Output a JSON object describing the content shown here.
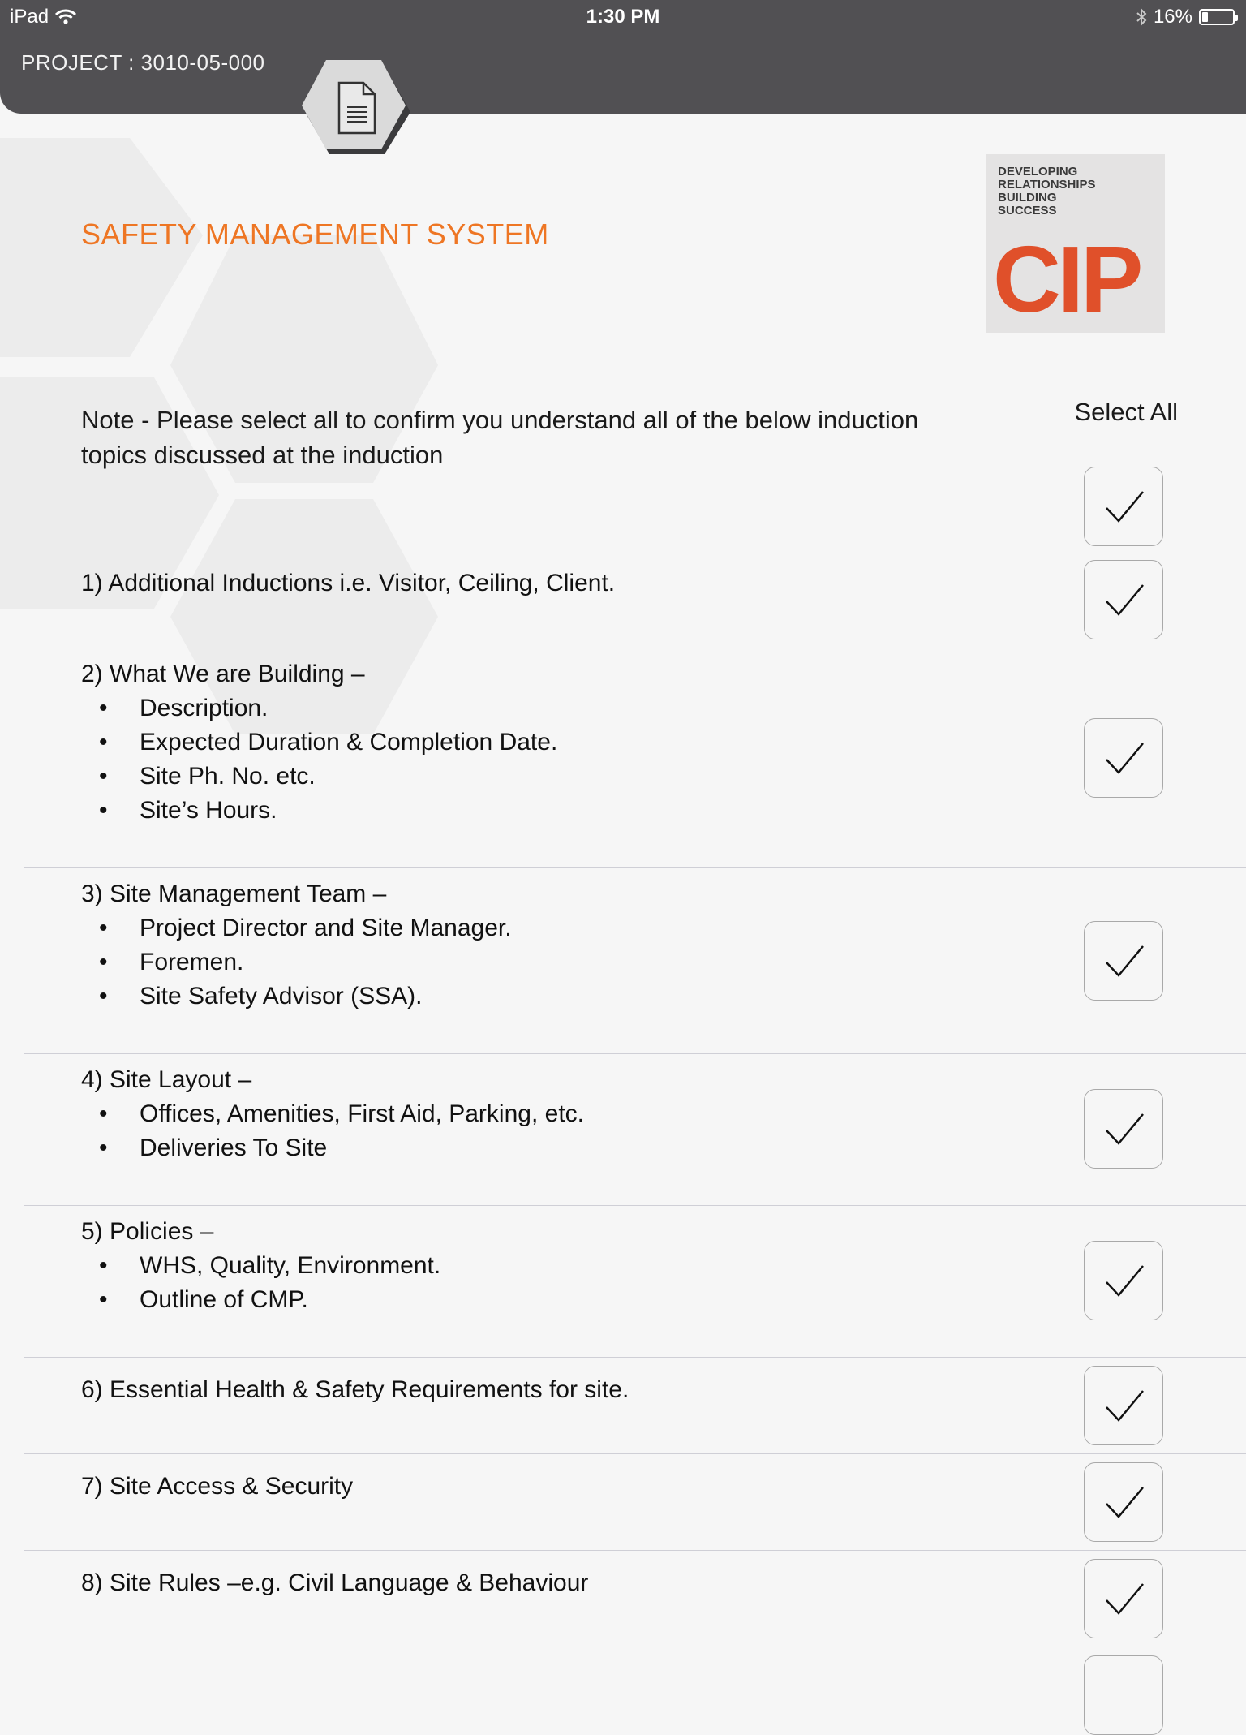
{
  "status_bar": {
    "device": "iPad",
    "time": "1:30 PM",
    "battery": "16%",
    "battery_level": 0.16
  },
  "header": {
    "project": "PROJECT : 3010-05-000",
    "doc_icon": "document-icon"
  },
  "title": "SAFETY MANAGEMENT SYSTEM",
  "logo": {
    "tagline": [
      "DEVELOPING",
      "RELATIONSHIPS",
      "BUILDING",
      "SUCCESS"
    ],
    "mark": "CIP",
    "color": "#e0502a"
  },
  "note": "Note - Please select all to confirm you understand all of the below induction topics discussed at the induction",
  "select_all": {
    "label": "Select All",
    "checked": true
  },
  "colors": {
    "accent": "#ee7624",
    "header": "#515053"
  },
  "items": [
    {
      "title": "1) Additional Inductions i.e. Visitor, Ceiling, Client.",
      "bullets": [],
      "checked": true
    },
    {
      "title": "2) What We are Building –",
      "bullets": [
        "Description.",
        "Expected Duration & Completion Date.",
        "Site Ph. No. etc.",
        "Site’s Hours."
      ],
      "checked": true
    },
    {
      "title": "3) Site Management Team –",
      "bullets": [
        "Project Director and Site Manager.",
        "Foremen.",
        "Site Safety Advisor (SSA)."
      ],
      "checked": true
    },
    {
      "title": "4) Site Layout –",
      "bullets": [
        "Offices, Amenities, First Aid, Parking, etc.",
        "Deliveries To Site"
      ],
      "checked": true
    },
    {
      "title": "5) Policies –",
      "bullets": [
        "WHS, Quality, Environment.",
        "Outline of CMP."
      ],
      "checked": true
    },
    {
      "title": "6) Essential Health & Safety Requirements for site.",
      "bullets": [],
      "checked": true
    },
    {
      "title": "7) Site Access & Security",
      "bullets": [],
      "checked": true
    },
    {
      "title": "8) Site Rules –e.g. Civil Language & Behaviour",
      "bullets": [],
      "checked": true
    }
  ]
}
